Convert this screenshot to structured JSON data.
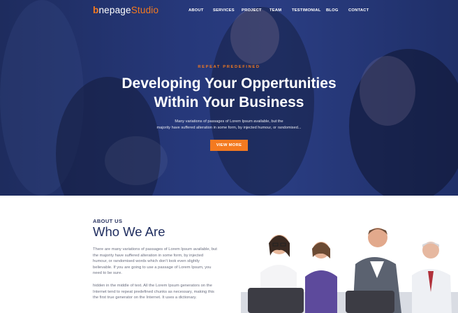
{
  "brand": {
    "mark": "b",
    "name_part1": "nepage",
    "name_part2": "Studio"
  },
  "nav": [
    "ABOUT",
    "SERVICES",
    "PROJECT",
    "TEAM",
    "TESTIMONIAL",
    "BLOG",
    "CONTACT"
  ],
  "hero": {
    "eyebrow": "REPEAT PREDEFINED",
    "headline_line1": "Developing Your Oppertunities",
    "headline_line2": "Within Your Business",
    "subtext_line1": "Many variations of passages of Lorem Ipsum available, but the",
    "subtext_line2": "majority have suffered alteration in some form, by injected humour, or randomised...",
    "cta_label": "VIEW MORE"
  },
  "about": {
    "eyebrow": "ABOUT US",
    "title": "Who We Are",
    "paragraph1": "There are many variations of passages of Lorem Ipsum available, but the majority have suffered alteration in some form, by injected humour, or randomised words which don't look even slightly believable. If you are going to use a passage of Lorem Ipsum, you need to be sure.",
    "paragraph2": "hidden in the middle of text. All the Lorem Ipsum generators on the Internet tend to repeat predefined chunks as necessary, making this the first true generator on the Internet. It uses a dictionary."
  },
  "colors": {
    "accent": "#f47a20",
    "navy": "#1e2c5e",
    "hero_overlay": "#26387a"
  }
}
